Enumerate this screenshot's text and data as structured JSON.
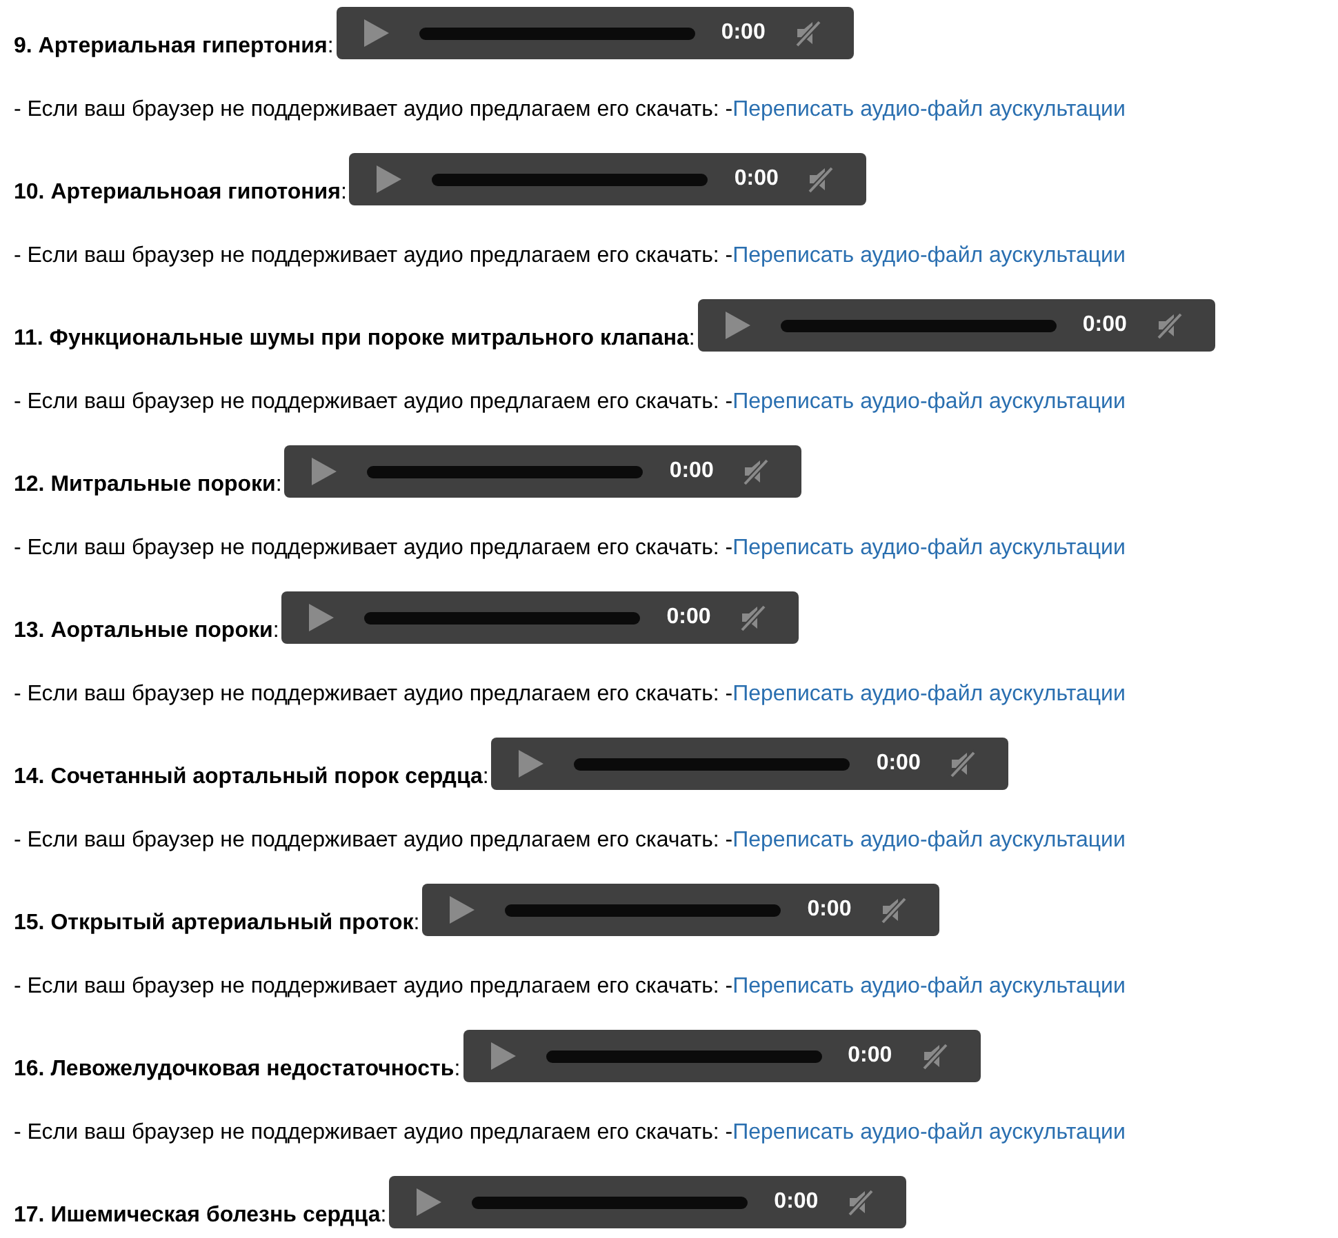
{
  "sections": [
    {
      "title": "**9. Артериальная гипертония**:",
      "player": {
        "time": "0:00"
      },
      "note": "- Если ваш браузер не поддерживает аудио предлагаем его скачать: -",
      "link": "Переписать аудио-файл аускультации"
    },
    {
      "title": "**10. Артериальноая гипотония**:",
      "player": {
        "time": "0:00"
      },
      "note": "- Если ваш браузер не поддерживает аудио предлагаем его скачать: -",
      "link": "Переписать аудио-файл аускультации"
    },
    {
      "title": "**11. Функциональные шумы при пороке митрального клапана**:",
      "player": {
        "time": "0:00"
      },
      "note": "- Если ваш браузер не поддерживает аудио предлагаем его скачать: -",
      "link": "Переписать аудио-файл аускультации"
    },
    {
      "title": "**12. Митральные пороки**:",
      "player": {
        "time": "0:00"
      },
      "note": "- Если ваш браузер не поддерживает аудио предлагаем его скачать: -",
      "link": "Переписать аудио-файл аускультации"
    },
    {
      "title": "**13. Аортальные пороки**:",
      "player": {
        "time": "0:00"
      },
      "note": "- Если ваш браузер не поддерживает аудио предлагаем его скачать: -",
      "link": "Переписать аудио-файл аускультации"
    },
    {
      "title": "**14. Сочетанный аортальный порок сердца**:",
      "player": {
        "time": "0:00"
      },
      "note": "- Если ваш браузер не поддерживает аудио предлагаем его скачать: -",
      "link": "Переписать аудио-файл аускультации"
    },
    {
      "title": "**15. Открытый артериальный проток**:",
      "player": {
        "time": "0:00"
      },
      "note": "- Если ваш браузер не поддерживает аудио предлагаем его скачать: -",
      "link": "Переписать аудио-файл аускультации"
    },
    {
      "title": "**16. Левожелудочковая недостаточность**:",
      "player": {
        "time": "0:00"
      },
      "note": "- Если ваш браузер не поддерживает аудио предлагаем его скачать: -",
      "link": "Переписать аудио-файл аускультации"
    },
    {
      "title": "**17. Ишемическая болезнь сердца**:",
      "player": {
        "time": "0:00"
      }
    }
  ]
}
